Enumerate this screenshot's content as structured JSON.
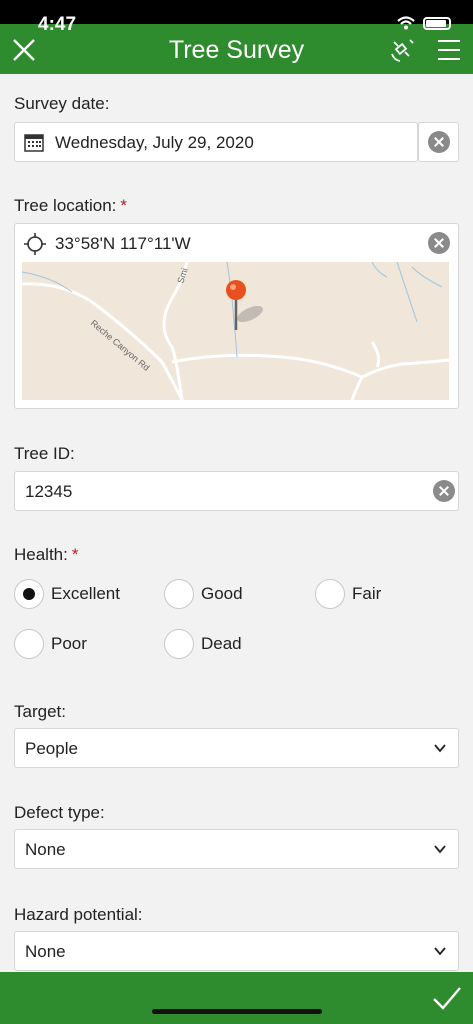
{
  "status_bar": {
    "time": "4:47"
  },
  "header": {
    "title": "Tree Survey"
  },
  "survey_date": {
    "label": "Survey date:",
    "value": "Wednesday, July 29, 2020"
  },
  "tree_location": {
    "label": "Tree location:",
    "required_mark": "*",
    "coordinates": "33°58'N 117°11'W",
    "map_labels": {
      "road": "Reche Canyon Rd",
      "road2": "Smi"
    }
  },
  "tree_id": {
    "label": "Tree ID:",
    "value": "12345"
  },
  "health": {
    "label": "Health:",
    "required_mark": "*",
    "options": [
      "Excellent",
      "Good",
      "Fair",
      "Poor",
      "Dead"
    ],
    "selected": "Excellent"
  },
  "target": {
    "label": "Target:",
    "value": "People"
  },
  "defect_type": {
    "label": "Defect type:",
    "value": "None"
  },
  "hazard_potential": {
    "label": "Hazard potential:",
    "value": "None"
  },
  "colors": {
    "brand": "#2e8b2e",
    "required": "#b21e1e",
    "pin": "#e8511d"
  }
}
